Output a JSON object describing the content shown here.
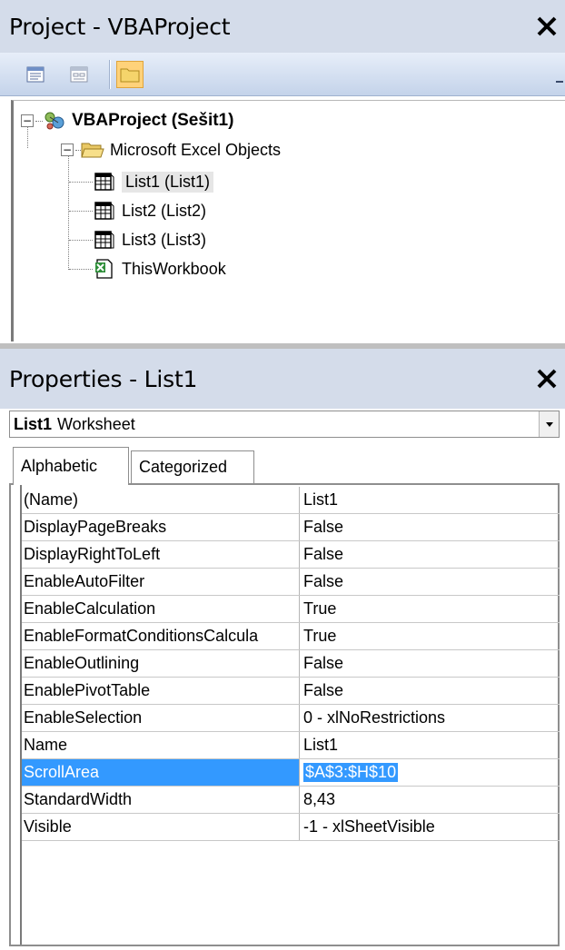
{
  "project_pane": {
    "title": "Project - VBAProject",
    "close_symbol": "✕",
    "toolbar": {
      "buttons": [
        {
          "name": "view-code-button",
          "icon": "code-view-icon",
          "active": false
        },
        {
          "name": "view-object-button",
          "icon": "form-view-icon",
          "active": false
        },
        {
          "name": "toggle-folders-button",
          "icon": "folder-icon",
          "active": true
        }
      ]
    },
    "tree": {
      "root": {
        "label": "VBAProject (Sešit1)",
        "icon": "vba-project-icon",
        "expander": "−"
      },
      "folder": {
        "label": "Microsoft Excel Objects",
        "icon": "open-folder-icon",
        "expander": "−"
      },
      "items": [
        {
          "label": "List1 (List1)",
          "icon": "worksheet-icon",
          "selected": true
        },
        {
          "label": "List2 (List2)",
          "icon": "worksheet-icon",
          "selected": false
        },
        {
          "label": "List3 (List3)",
          "icon": "worksheet-icon",
          "selected": false
        },
        {
          "label": "ThisWorkbook",
          "icon": "workbook-icon",
          "selected": false
        }
      ]
    }
  },
  "properties_pane": {
    "title": "Properties - List1",
    "close_symbol": "✕",
    "object_combo": {
      "object_name": "List1",
      "object_type": "Worksheet",
      "drop_symbol": "▼"
    },
    "tabs": [
      {
        "label": "Alphabetic",
        "active": true
      },
      {
        "label": "Categorized",
        "active": false
      }
    ],
    "rows": [
      {
        "name": "(Name)",
        "value": "List1",
        "selected": false
      },
      {
        "name": "DisplayPageBreaks",
        "value": "False",
        "selected": false
      },
      {
        "name": "DisplayRightToLeft",
        "value": "False",
        "selected": false
      },
      {
        "name": "EnableAutoFilter",
        "value": "False",
        "selected": false
      },
      {
        "name": "EnableCalculation",
        "value": "True",
        "selected": false
      },
      {
        "name": "EnableFormatConditionsCalcula",
        "value": "True",
        "selected": false
      },
      {
        "name": "EnableOutlining",
        "value": "False",
        "selected": false
      },
      {
        "name": "EnablePivotTable",
        "value": "False",
        "selected": false
      },
      {
        "name": "EnableSelection",
        "value": "0 - xlNoRestrictions",
        "selected": false
      },
      {
        "name": "Name",
        "value": "List1",
        "selected": false
      },
      {
        "name": "ScrollArea",
        "value": "$A$3:$H$10",
        "selected": true
      },
      {
        "name": "StandardWidth",
        "value": "8,43",
        "selected": false
      },
      {
        "name": "Visible",
        "value": "-1 - xlSheetVisible",
        "selected": false
      }
    ]
  },
  "colors": {
    "title_bar": "#d4dcea",
    "selection": "#3399ff",
    "toolbar_active": "#ffd27a"
  }
}
